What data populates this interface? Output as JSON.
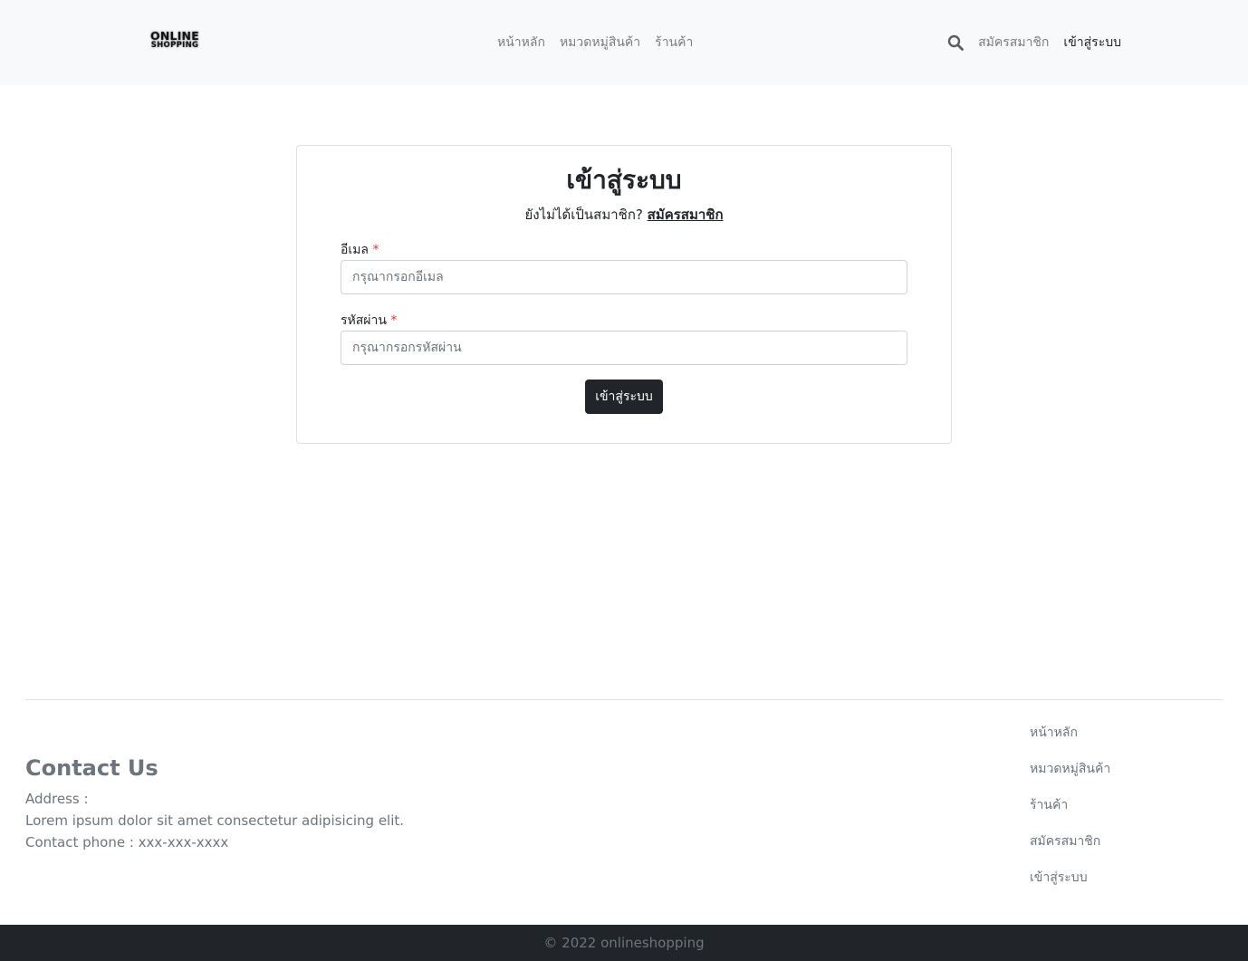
{
  "navbar": {
    "logo_line1": "ONLINE",
    "logo_line2": "SHOPPING",
    "center_links": [
      "หน้าหลัก",
      "หมวดหมู่สินค้า",
      "ร้านค้า"
    ],
    "register_label": "สมัครสมาชิก",
    "login_label": "เข้าสู่ระบบ",
    "search_icon": "search-icon"
  },
  "login": {
    "title": "เข้าสู่ระบบ",
    "not_member_text": "ยังไม่ได้เป็นสมาชิก?",
    "register_link": "สมัครสมาชิก",
    "email_label": "อีเมล",
    "email_placeholder": "กรุณากรอกอีเมล",
    "email_value": "",
    "password_label": "รหัสผ่าน",
    "password_placeholder": "กรุณากรอกรหัสผ่าน",
    "password_value": "",
    "required_mark": "*",
    "submit_label": "เข้าสู่ระบบ"
  },
  "footer": {
    "contact_title": "Contact Us",
    "address_label": "Address :",
    "address_text": "Lorem ipsum dolor sit amet consectetur adipisicing elit.",
    "phone_text": "Contact phone : xxx-xxx-xxxx",
    "links": [
      "หน้าหลัก",
      "หมวดหมู่สินค้า",
      "ร้านค้า",
      "สมัครสมาชิก",
      "เข้าสู่ระบบ"
    ],
    "copyright": "© 2022 onlineshopping"
  },
  "colors": {
    "navbar_bg": "#f8f9fa",
    "dark": "#212529",
    "muted": "#6c757d",
    "required": "#dc3545"
  }
}
